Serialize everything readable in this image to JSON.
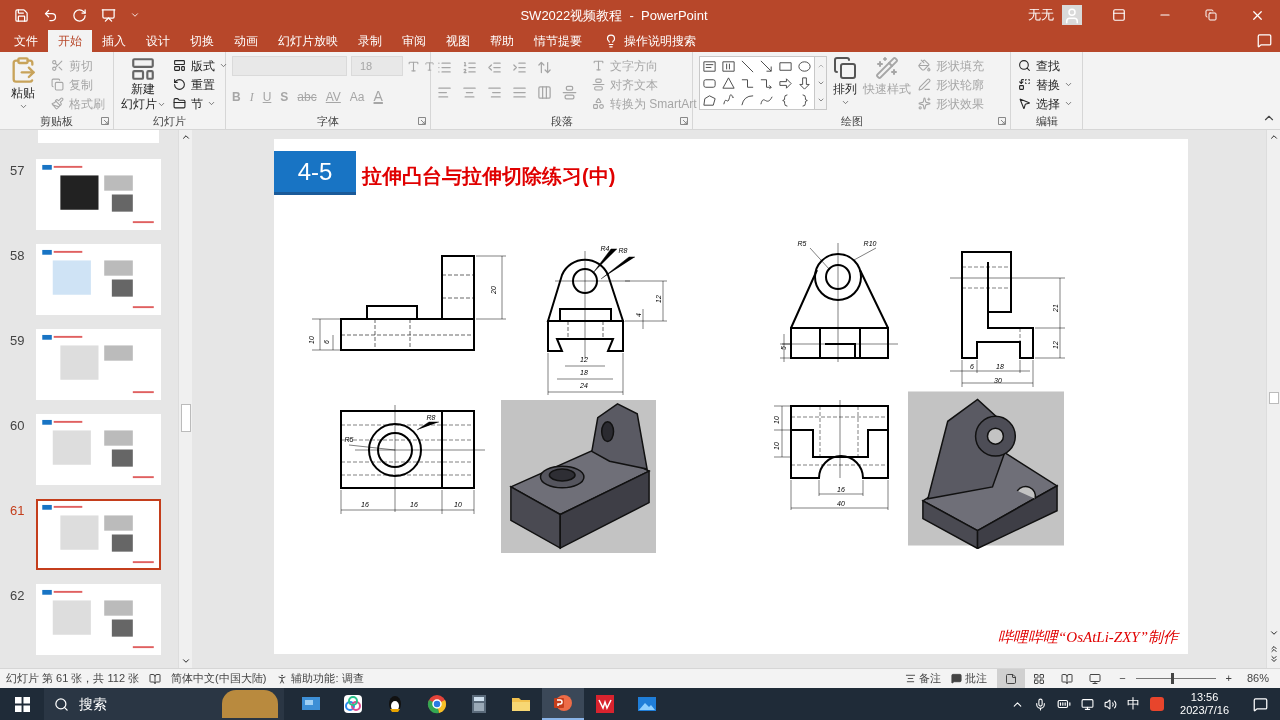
{
  "window": {
    "title": "SW2022视频教程  -  PowerPoint",
    "user": "无无"
  },
  "ribbon_tabs": [
    {
      "label": "文件",
      "selected": false
    },
    {
      "label": "开始",
      "selected": true
    },
    {
      "label": "插入",
      "selected": false
    },
    {
      "label": "设计",
      "selected": false
    },
    {
      "label": "切换",
      "selected": false
    },
    {
      "label": "动画",
      "selected": false
    },
    {
      "label": "幻灯片放映",
      "selected": false
    },
    {
      "label": "录制",
      "selected": false
    },
    {
      "label": "审阅",
      "selected": false
    },
    {
      "label": "视图",
      "selected": false
    },
    {
      "label": "帮助",
      "selected": false
    },
    {
      "label": "情节提要",
      "selected": false
    }
  ],
  "tell_me": "操作说明搜索",
  "clipboard": {
    "label": "剪贴板",
    "paste": "粘贴",
    "items": [
      {
        "label": "剪切",
        "disabled": true
      },
      {
        "label": "复制",
        "disabled": true
      },
      {
        "label": "格式刷",
        "disabled": true
      }
    ]
  },
  "slides_group": {
    "label": "幻灯片",
    "new_slide": [
      "新建",
      "幻灯片"
    ],
    "items": [
      {
        "label": "版式",
        "disabled": false
      },
      {
        "label": "重置",
        "disabled": false
      },
      {
        "label": "节",
        "disabled": false
      }
    ]
  },
  "font": {
    "label": "字体",
    "size": "18",
    "disabled": true,
    "buttons": [
      {
        "kind": "bold",
        "label": "B"
      },
      {
        "kind": "italic",
        "label": "I"
      },
      {
        "kind": "underline",
        "label": "U"
      },
      {
        "kind": "shadow",
        "label": "S"
      },
      {
        "kind": "strike",
        "label": "abc"
      },
      {
        "kind": "spacing",
        "label": "AV"
      },
      {
        "kind": "case",
        "label": "Aa"
      },
      {
        "kind": "color",
        "label": "A"
      }
    ]
  },
  "paragraph": {
    "label": "段落",
    "items": [
      {
        "label": "文字方向",
        "disabled": true
      },
      {
        "label": "对齐文本",
        "disabled": true
      },
      {
        "label": "转换为 SmartArt",
        "disabled": true
      }
    ]
  },
  "drawing": {
    "label": "绘图",
    "arrange": "排列",
    "quick_styles": {
      "label": "快速样式",
      "disabled": true
    },
    "items": [
      {
        "label": "形状填充",
        "disabled": true
      },
      {
        "label": "形状轮廓",
        "disabled": true
      },
      {
        "label": "形状效果",
        "disabled": true
      }
    ]
  },
  "editing": {
    "label": "编辑",
    "items": [
      {
        "label": "查找"
      },
      {
        "label": "替换"
      },
      {
        "label": "选择"
      }
    ]
  },
  "thumbnails": [
    {
      "number": "57",
      "selected": false
    },
    {
      "number": "58",
      "selected": false
    },
    {
      "number": "59",
      "selected": false
    },
    {
      "number": "60",
      "selected": false
    },
    {
      "number": "61",
      "selected": true
    },
    {
      "number": "62",
      "selected": false
    }
  ],
  "slide": {
    "badge": "4-5",
    "title": "拉伸凸台与拉伸切除练习(中)",
    "footer": "哔哩哔哩“OsAtLi-ZXY”制作",
    "views": [
      {
        "dims": [
          "10",
          "6",
          "20"
        ]
      },
      {
        "dims": [
          "R4",
          "R8",
          "12",
          "4",
          "12",
          "18",
          "24"
        ]
      },
      {
        "dims": [
          "R5",
          "R8",
          "16",
          "16",
          "10"
        ]
      },
      {
        "dims": [
          "R5",
          "R10",
          "5"
        ]
      },
      {
        "dims": [
          "21",
          "12",
          "6",
          "18",
          "30"
        ]
      },
      {
        "dims": [
          "10",
          "10",
          "16",
          "40"
        ]
      }
    ]
  },
  "status_bar": {
    "slide_info": "幻灯片 第 61 张，共 112 张",
    "language": "简体中文(中国大陆)",
    "accessibility": "辅助功能: 调查",
    "notes": "备注",
    "comments": "批注",
    "views": [
      {
        "selected": true
      },
      {
        "selected": false
      },
      {
        "selected": false
      },
      {
        "selected": false
      }
    ],
    "zoom_out": "−",
    "zoom_in": "+",
    "zoom": {
      "level": 0.45
    },
    "zoom_text": "86%"
  },
  "taskbar": {
    "search": "搜索",
    "apps": [
      {
        "kind": "desktop",
        "selected": false
      },
      {
        "kind": "cloud",
        "selected": false
      },
      {
        "kind": "penguin",
        "selected": false
      },
      {
        "kind": "browser",
        "selected": false
      },
      {
        "kind": "calculator",
        "selected": false
      },
      {
        "kind": "folder",
        "selected": false
      },
      {
        "kind": "slides",
        "selected": true
      },
      {
        "kind": "cad",
        "selected": false
      },
      {
        "kind": "photos",
        "selected": false
      }
    ],
    "ime": "中",
    "time": "13:56",
    "date": "2023/7/16"
  }
}
